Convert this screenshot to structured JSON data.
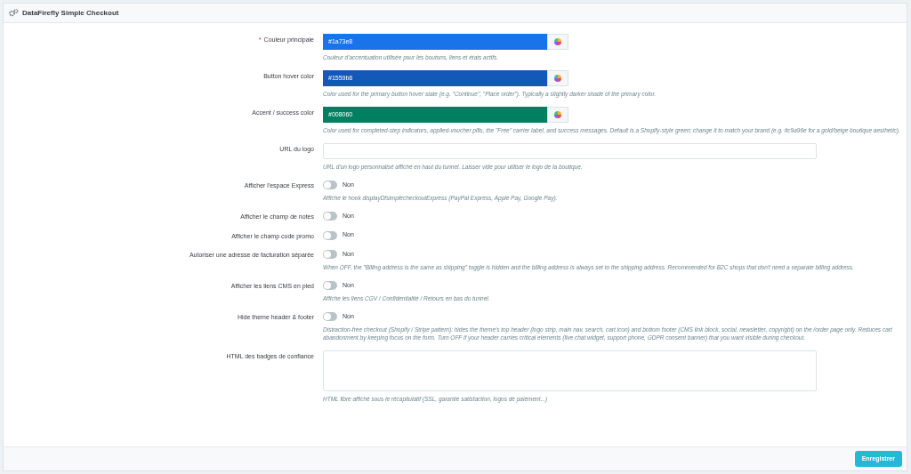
{
  "panel": {
    "title": "DataFirefly Simple Checkout"
  },
  "fields": [
    {
      "kind": "color",
      "label": "Couleur principale",
      "marker": "*",
      "value": "#1a73e8",
      "color": "#1a73e8",
      "help": "Couleur d'accentuation utilisée pour les boutons, liens et états actifs."
    },
    {
      "kind": "color",
      "label": "Button hover color",
      "value": "#1559b8",
      "color": "#1559b8",
      "help": "Color used for the primary button hover state (e.g. \"Continue\", \"Place order\"). Typically a slightly darker shade of the primary color."
    },
    {
      "kind": "color",
      "label": "Accent / success color",
      "value": "#008060",
      "color": "#008060",
      "help": "Color used for completed-step indicators, applied-voucher pills, the \"Free\" carrier label, and success messages. Default is a Shopify-style green; change it to match your brand (e.g. #c9a96e for a gold/beige boutique aesthetic)."
    },
    {
      "kind": "text",
      "label": "URL du logo",
      "help": "URL d'un logo personnalisé affiché en haut du tunnel. Laisser vide pour utiliser le logo de la boutique."
    },
    {
      "kind": "toggle",
      "label": "Afficher l'espace Express",
      "on": false,
      "state": "Non",
      "help": "Affiche le hook displayDfsimplecheckoutExpress (PayPal Express, Apple Pay, Google Pay)."
    },
    {
      "kind": "toggle",
      "label": "Afficher le champ de notes",
      "on": false,
      "state": "Non"
    },
    {
      "kind": "toggle",
      "label": "Afficher le champ code promo",
      "on": false,
      "state": "Non"
    },
    {
      "kind": "toggle",
      "label": "Autoriser une adresse de facturation séparée",
      "on": false,
      "state": "Non",
      "help": "When OFF, the \"Billing address is the same as shipping\" toggle is hidden and the billing address is always set to the shipping address. Recommended for B2C shops that don't need a separate billing address."
    },
    {
      "kind": "toggle",
      "label": "Afficher les liens CMS en pied",
      "on": false,
      "state": "Non",
      "help": "Affiche les liens CGV / Confidentialité / Retours en bas du tunnel."
    },
    {
      "kind": "toggle",
      "label": "Hide theme header & footer",
      "on": false,
      "state": "Non",
      "help": "Distraction-free checkout (Shopify / Stripe pattern): hides the theme's top header (logo strip, main nav, search, cart icon) and bottom footer (CMS link block, social, newsletter, copyright) on the /order page only. Reduces cart abandonment by keeping focus on the form. Turn OFF if your header carries critical elements (live chat widget, support phone, GDPR consent banner) that you want visible during checkout."
    },
    {
      "kind": "textarea",
      "label": "HTML des badges de confiance",
      "help": "HTML libre affiché sous le récapitulatif (SSL, garantie satisfaction, logos de paiement...)"
    }
  ],
  "save_button": "Enregistrer"
}
